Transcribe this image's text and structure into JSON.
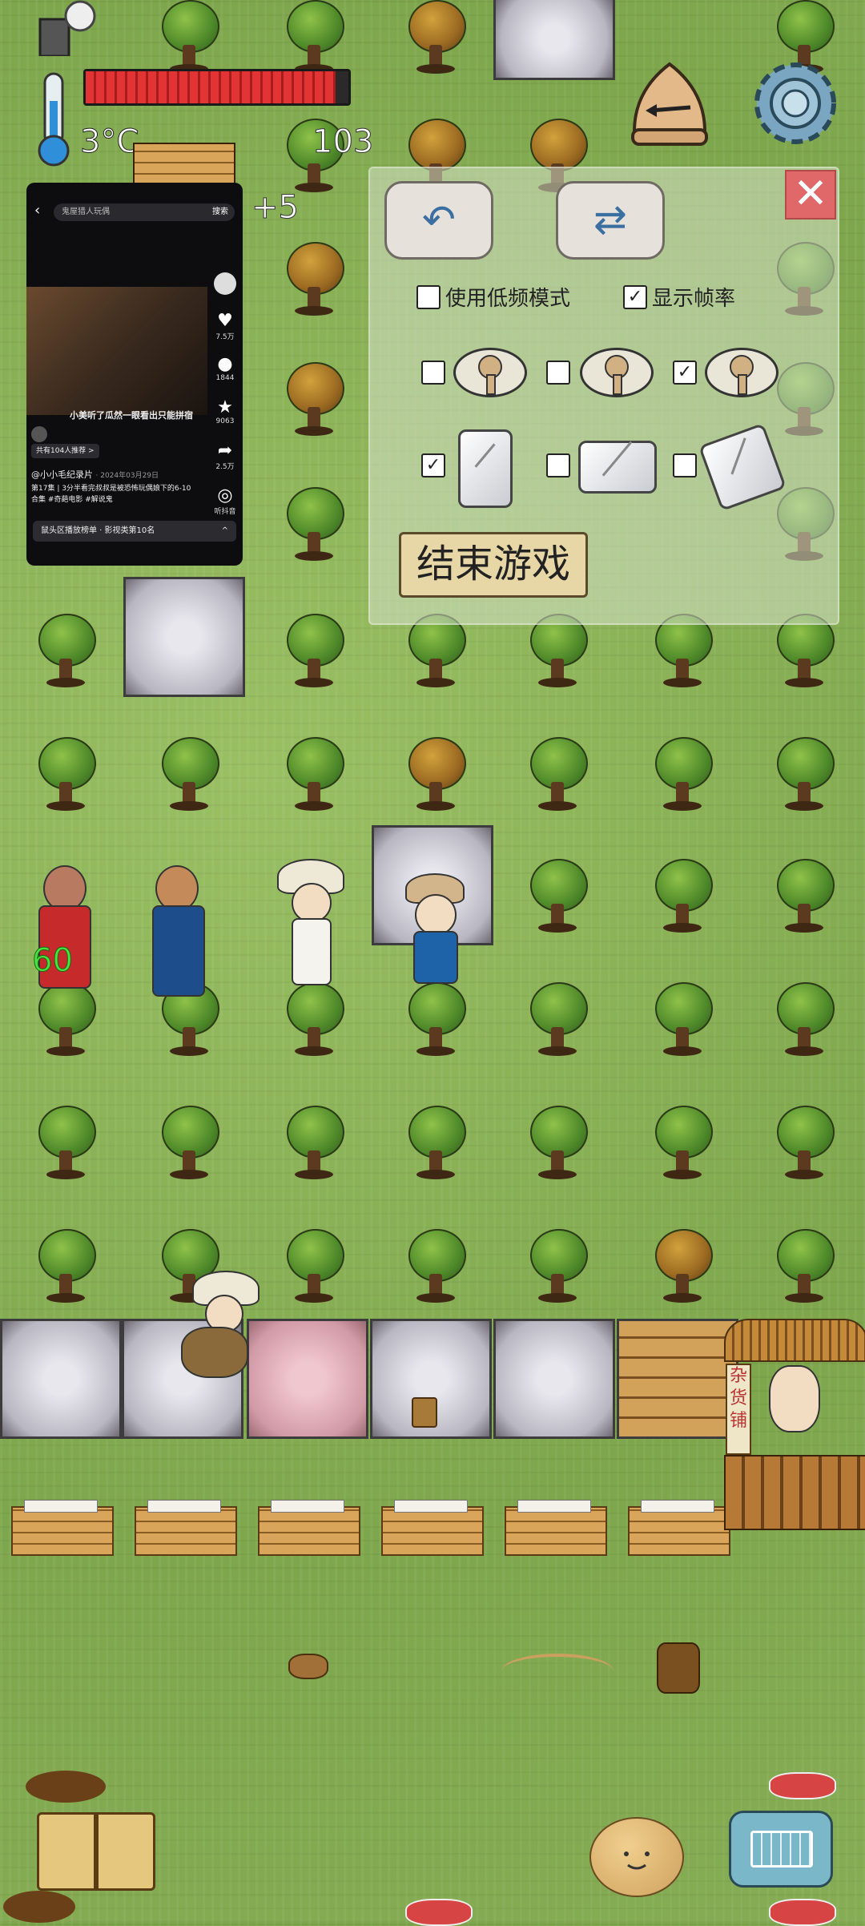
{
  "hud": {
    "temperature": "3°C",
    "hunger_fraction": 0.95,
    "food_counter": "103",
    "bonus": "+5",
    "nearby_age": "60"
  },
  "video_overlay": {
    "search_text": "鬼屋猎人玩偶",
    "search_button": "搜索",
    "title": "小美听了瓜然一眼看出只能拼宿",
    "likes": "7.5万",
    "comments": "1844",
    "favorites": "9063",
    "shares": "2.5万",
    "listen": "听抖音",
    "author": "@小小毛纪录片",
    "date": "· 2024年03月29日",
    "collection": "第17集 | 3分半看完叔叔是被恐怖玩偶娘下的6-10",
    "tags": "合集 #奇葩电影 #解说鬼",
    "tag_pill": "共有104人推荐 >",
    "bottom_bar": "鼠头区播放榜单 · 影视类第10名"
  },
  "settings": {
    "low_freq_label": "使用低频模式",
    "low_freq_checked": false,
    "show_fps_label": "显示帧率",
    "show_fps_checked": true,
    "view_options": [
      false,
      false,
      true
    ],
    "device_options": [
      true,
      false,
      false
    ],
    "end_game_label": "结束游戏",
    "close_symbol": "✕",
    "undo_symbol": "↶",
    "redo_symbol": "⇄"
  },
  "stall": {
    "sign_text": "杂货铺"
  },
  "colors": {
    "grass": "#86ad55",
    "hunger_red": "#e23434",
    "close_red": "#e06868",
    "age_green": "#4ae23e"
  }
}
